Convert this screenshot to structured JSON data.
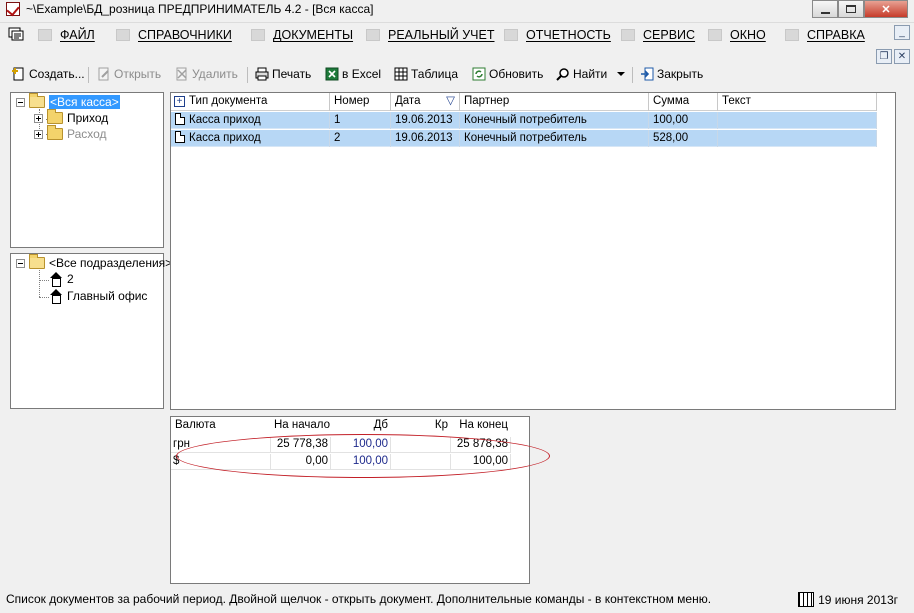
{
  "window": {
    "title": "~\\Example\\БД_розница  ПРЕДПРИНИМАТЕЛЬ 4.2 - [Вся касса]",
    "min_icon": "minimize-icon",
    "max_icon": "maximize-icon",
    "close_label": "✕"
  },
  "menu": {
    "items": [
      {
        "label": "ФАЙЛ",
        "icon": "folder-icon"
      },
      {
        "label": "СПРАВОЧНИКИ",
        "icon": "home-icon"
      },
      {
        "label": "ДОКУМЕНТЫ",
        "icon": "document-icon"
      },
      {
        "label": "РЕАЛЬНЫЙ УЧЕТ",
        "icon": "ledger-icon"
      },
      {
        "label": "ОТЧЕТНОСТЬ",
        "icon": "report-icon"
      },
      {
        "label": "СЕРВИС",
        "icon": "service-icon"
      },
      {
        "label": "ОКНО",
        "icon": "window-icon"
      },
      {
        "label": "СПРАВКА",
        "icon": "help-icon"
      }
    ],
    "mdi_min": "_",
    "mdi_restore": "❐",
    "mdi_close": "✕"
  },
  "toolbar": {
    "create": "Создать...",
    "open": "Открыть",
    "delete": "Удалить",
    "print": "Печать",
    "excel": "в Excel",
    "table": "Таблица",
    "refresh": "Обновить",
    "find": "Найти",
    "close": "Закрыть"
  },
  "cash_tree": {
    "root": "<Вся касса>",
    "children": [
      "Приход",
      "Расход"
    ]
  },
  "dept_tree": {
    "root": "<Все подразделения>",
    "children": [
      "2",
      "Главный офис"
    ]
  },
  "documents": {
    "columns": [
      "Тип документа",
      "Номер",
      "Дата",
      "Партнер",
      "Сумма",
      "Текст"
    ],
    "add_symbol": "+",
    "sort_symbol": "▽",
    "rows": [
      {
        "type": "Касса приход",
        "number": "1",
        "date": "19.06.2013",
        "partner": "Конечный потребитель",
        "sum": "100,00",
        "text": ""
      },
      {
        "type": "Касса приход",
        "number": "2",
        "date": "19.06.2013",
        "partner": "Конечный потребитель",
        "sum": "528,00",
        "text": ""
      }
    ]
  },
  "totals": {
    "columns": [
      "Валюта",
      "На начало",
      "Дб",
      "Кр",
      "На конец"
    ],
    "rows": [
      {
        "currency": "грн",
        "start": "25 778,38",
        "debit": "100,00",
        "credit": "",
        "end": "25 878,38"
      },
      {
        "currency": "$",
        "start": "0,00",
        "debit": "100,00",
        "credit": "",
        "end": "100,00"
      }
    ]
  },
  "status": {
    "message": "Список документов за рабочий период. Двойной щелчок - открыть документ. Дополнительные команды - в контекстном меню.",
    "date": "19 июня 2013г"
  },
  "colors": {
    "selection": "#3399ff",
    "row_highlight": "#b7d7f5",
    "annotation": "#c21f27"
  }
}
